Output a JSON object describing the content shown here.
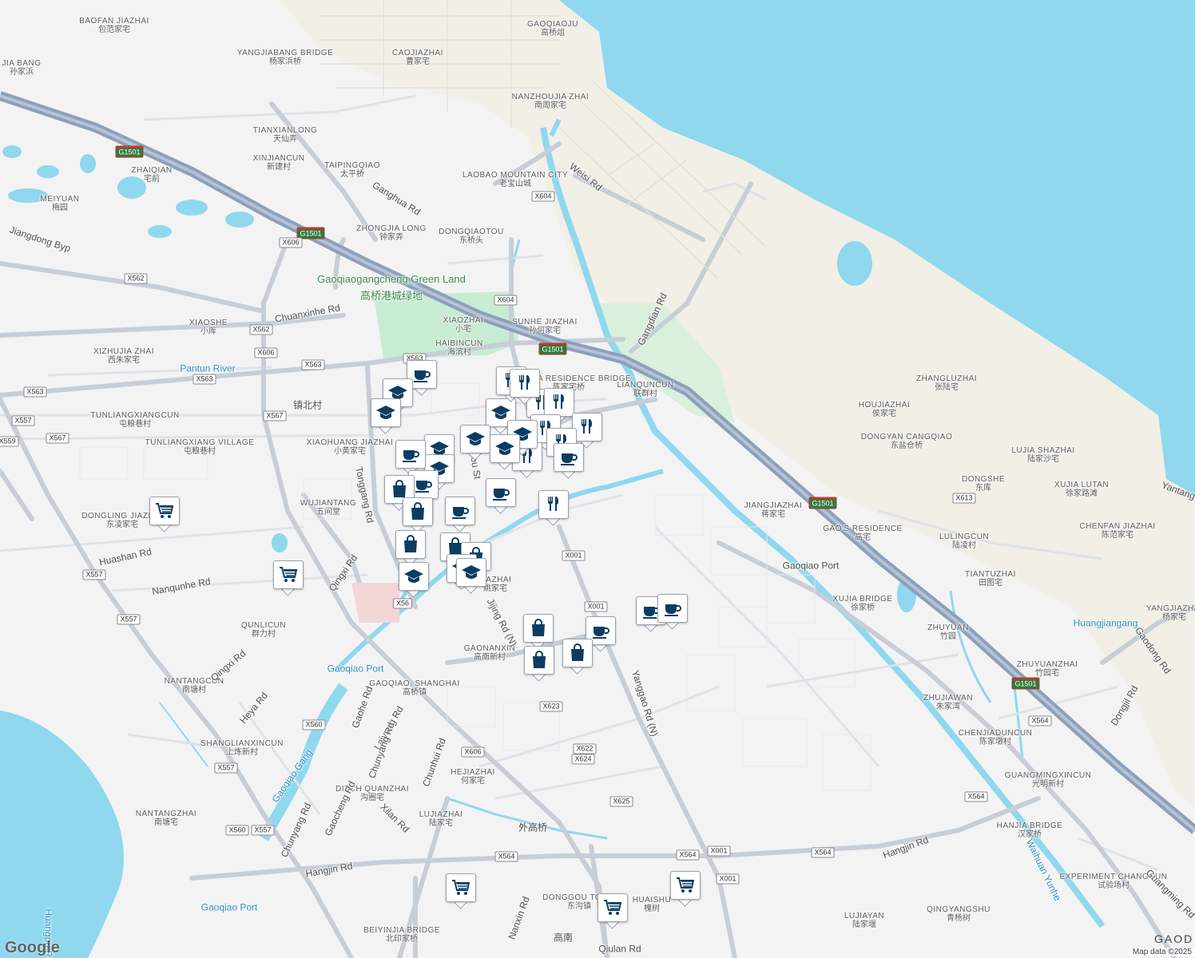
{
  "map": {
    "colors": {
      "water": "#8fd8ee",
      "land": "#f3f3f4",
      "reclaimed": "#f1efe6",
      "park": "#c8ecd3",
      "road": "#c7ced6",
      "highway": "#8da0bb"
    },
    "labels": [
      {
        "en": "BAOFAN JIAZHAI",
        "zh": "包范家宅"
      },
      {
        "en": "YANGJIABANG BRIDGE",
        "zh": "杨家浜桥"
      },
      {
        "en": "CAOJIAZHAI",
        "zh": "曹家宅"
      },
      {
        "en": "GAOQIAOJU",
        "zh": "高桥俎"
      },
      {
        "en": "JIA BANG",
        "zh": "孙家浜"
      },
      {
        "en": "NANZHOUJIA ZHAI",
        "zh": "南周家宅"
      },
      {
        "en": "TIANXIANLONG",
        "zh": "天仙弄"
      },
      {
        "en": "XINJIANCUN",
        "zh": "新建村"
      },
      {
        "en": "TAIPINGQIAO",
        "zh": "太平桥"
      },
      {
        "en": "ZHAIQIAN",
        "zh": "宅前"
      },
      {
        "en": "LAOBAO MOUNTAIN CITY",
        "zh": "老宝山城"
      },
      {
        "en": "MEIYUAN",
        "zh": "梅园"
      },
      {
        "en": "ZHONGJIA LONG",
        "zh": "钟家弄"
      },
      {
        "en": "DONGQIAOTOU",
        "zh": "东桥头"
      },
      {
        "en": "XIAOSHE",
        "zh": "小厍"
      },
      {
        "en": "XIAOZHAI",
        "zh": "小宅"
      },
      {
        "en": "SUNHE JIAZHAI",
        "zh": "孙何家宅"
      },
      {
        "en": "HAIBINCUN",
        "zh": "海滨村"
      },
      {
        "en": "XIZHUJIA ZHAI",
        "zh": "西朱家宅"
      },
      {
        "en": "CHENJIA RESIDENCE BRIDGE",
        "zh": "陈家宅桥"
      },
      {
        "en": "LIANQUNCUN",
        "zh": "联群村"
      },
      {
        "en": "ZHANGLUZHAI",
        "zh": "张陆宅"
      },
      {
        "en": "HOUJIAZHAI",
        "zh": "侯家宅"
      },
      {
        "en": "DONGYAN CANGQIAO",
        "zh": "东盐仓桥"
      },
      {
        "en": "LUJIA SHAZHAI",
        "zh": "陆家沙宅"
      },
      {
        "en": "DONGSHE",
        "zh": "东库"
      },
      {
        "en": "XUJIA LUTAN",
        "zh": "徐家路滩"
      },
      {
        "en": "CHENFAN JIAZHAI",
        "zh": "陈范家宅"
      },
      {
        "en": "TUNLIANGXIANGCUN",
        "zh": "屯粮巷村"
      },
      {
        "en": "TUNLIANGXIANG VILLAGE",
        "zh": "屯粮巷村"
      },
      {
        "en": "XIAOHUANG JIAZHAI",
        "zh": "小黄家宅"
      },
      {
        "en": "WUJIANTANG",
        "zh": "五间堂"
      },
      {
        "en": "JIANGJIAZHAI",
        "zh": "蒋家宅"
      },
      {
        "en": "GAO'S RESIDENCE",
        "zh": "高宅"
      },
      {
        "en": "LULINGCUN",
        "zh": "陆凌村"
      },
      {
        "en": "DONGLING JIAZHAI",
        "zh": "东凌家宅"
      },
      {
        "en": "TIANTUZHAI",
        "zh": "田图宅"
      },
      {
        "en": "XUJIA BRIDGE",
        "zh": "徐家桥"
      },
      {
        "en": "ZHUYUAN",
        "zh": "竹园"
      },
      {
        "en": "ZHUYUANZHAI",
        "zh": "竹园宅"
      },
      {
        "en": "YANGJIAZHAI",
        "zh": "杨家宅"
      },
      {
        "en": "QUNLICUN",
        "zh": "群力村"
      },
      {
        "en": "JIAZHAI",
        "zh": "姚家宅"
      },
      {
        "en": "GAONANXIN",
        "zh": "高南新村"
      },
      {
        "en": "NANTANGCUN",
        "zh": "南塘村"
      },
      {
        "en": "GAOQIAO, SHANGHAI",
        "zh": "高桥镇"
      },
      {
        "en": "ZHUJIAWAN",
        "zh": "朱家湾"
      },
      {
        "en": "CHENJIADUNCUN",
        "zh": "陈家墩村"
      },
      {
        "en": "GUANGMINGXINCUN",
        "zh": "光明新村"
      },
      {
        "en": "SHANGLIANXINCUN",
        "zh": "上炼新村"
      },
      {
        "en": "HEJIAZHAI",
        "zh": "何家宅"
      },
      {
        "en": "DITCH QUANZHAI",
        "zh": "沟圈宅"
      },
      {
        "en": "LUJIAZHAI",
        "zh": "陆家宅"
      },
      {
        "en": "HANJIA BRIDGE",
        "zh": "汉家桥"
      },
      {
        "en": "NANTANGZHAI",
        "zh": "南塘宅"
      },
      {
        "en": "EXPERIMENT CHANGCUN",
        "zh": "试验场村"
      },
      {
        "en": "LUJIAYAN",
        "zh": "陆家堰"
      },
      {
        "en": "QINGYANGSHU",
        "zh": "青杨树"
      },
      {
        "en": "DONGGOU TOWN",
        "zh": "东沟镇"
      },
      {
        "en": "HUAISHU",
        "zh": "槐树"
      },
      {
        "en": "BEIYINJIA BRIDGE",
        "zh": "北印家桥"
      }
    ],
    "water_labels": [
      "Pantun River",
      "Gaoqiao Port",
      "Gaoqiao Port",
      "Gaoqiao Port",
      "Huangjiangang",
      "Gaoqiao Gang",
      "Waihuan Yunhe",
      "Huangpu Ri"
    ],
    "green_labels": [
      "Gaoqiaogangcheng Green Land",
      "高桥港城绿地"
    ],
    "town_labels": [
      "外高桥",
      "高南"
    ],
    "road_labels": [
      "Ganghua Rd",
      "Jiangdong Byp",
      "Chuanxinhe Rd",
      "Weisi Rd",
      "Gangdian Rd",
      "Tonggang Rd",
      "Huashan Rd",
      "Nanqunhe Rd",
      "Qingxi Rd",
      "Qingxi Rd",
      "Jijing Rd (N)",
      "Yanggao Rd (N)",
      "Heya Rd",
      "Gaohe Rd",
      "Laiyang Rd",
      "Chunyang Rd",
      "Gaocheng Rd",
      "Chunyang Rd",
      "Chunhui Rd",
      "Xilan Rd",
      "Hangjin Rd",
      "Hangjin Rd",
      "Nanxin Rd",
      "Qiulan Rd",
      "Gaodong Rd",
      "Dongjil Rd",
      "Guangming Rd",
      "Yantang",
      "Xue",
      "zhou St",
      "镇北村",
      "Gaoqiao Port"
    ],
    "shields": [
      "G1501",
      "G1501",
      "G1501",
      "G1501",
      "G1501",
      "X604",
      "X604",
      "X606",
      "X606",
      "X606",
      "X562",
      "X562",
      "X563",
      "X563",
      "X563",
      "X563",
      "X567",
      "X567",
      "X557",
      "X557",
      "X557",
      "X557",
      "X557",
      "X559",
      "X613",
      "X564",
      "X564",
      "X564",
      "X564",
      "X564",
      "X560",
      "X560",
      "X001",
      "X001",
      "X001",
      "X001",
      "X623",
      "X622",
      "X624",
      "X625",
      "X56"
    ],
    "pois": [
      "cafe",
      "school",
      "school",
      "school",
      "dining",
      "dining",
      "dining",
      "dining",
      "dining",
      "dining",
      "dining",
      "dining",
      "school",
      "school",
      "school",
      "school",
      "cafe",
      "cafe",
      "cafe",
      "cafe",
      "cafe",
      "cafe",
      "cafe",
      "cafe",
      "cafe",
      "shopping",
      "shopping",
      "shopping",
      "shopping",
      "shopping",
      "shopping",
      "shopping",
      "shopping",
      "school",
      "school",
      "school",
      "school",
      "grocery",
      "grocery",
      "grocery",
      "grocery",
      "grocery",
      "dining"
    ],
    "attribution": "Map data ©2025",
    "brand": "Google",
    "corner_text": "GAOD"
  }
}
